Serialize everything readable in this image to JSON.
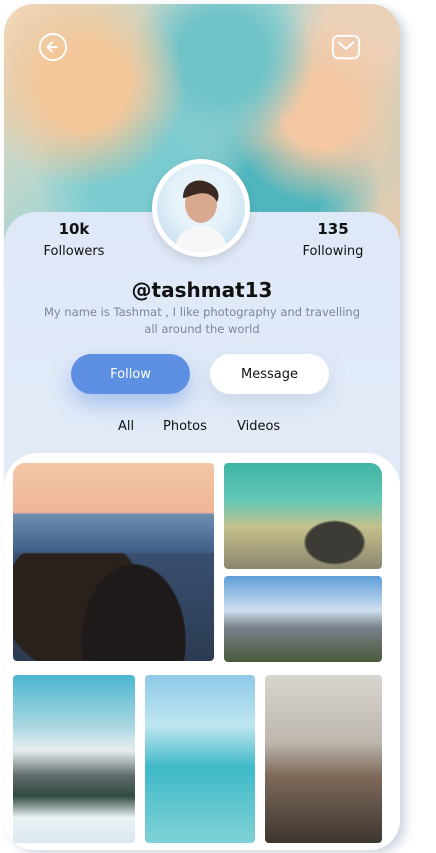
{
  "profile": {
    "username": "@tashmat13",
    "bio": "My name is Tashmat , I like photography and travelling all around the world",
    "stats": {
      "followers_count": "10k",
      "followers_label": "Followers",
      "following_count": "135",
      "following_label": "Following"
    }
  },
  "actions": {
    "follow_label": "Follow",
    "message_label": "Message"
  },
  "tabs": [
    {
      "label": "All"
    },
    {
      "label": "Photos"
    },
    {
      "label": "Videos"
    }
  ],
  "icons": {
    "back": "back-arrow-icon",
    "mail": "mail-icon"
  },
  "colors": {
    "accent": "#5d8fe2",
    "panel": "#e6edf8"
  }
}
